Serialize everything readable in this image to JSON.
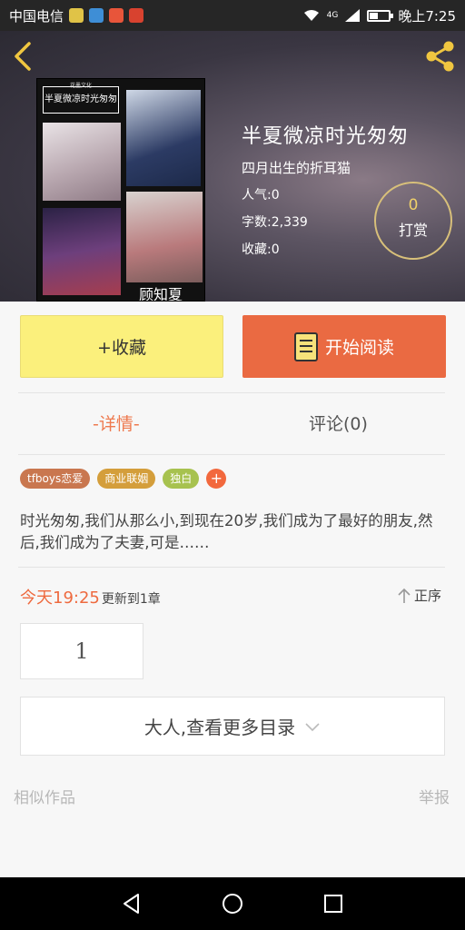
{
  "status_bar": {
    "carrier": "中国电信",
    "network": "4G",
    "time": "晚上7:25"
  },
  "hero": {
    "cover_title": "半夏微凉时光匆匆",
    "cover_subtitle": "花墨文化",
    "cover_author": "顾知夏",
    "title": "半夏微凉时光匆匆",
    "author": "四月出生的折耳猫",
    "popularity": "人气:0",
    "word_count": "字数:2,339",
    "favorites": "收藏:0",
    "reward_count": "0",
    "reward_label": "打赏"
  },
  "actions": {
    "collect_label": "+收藏",
    "read_label": "开始阅读"
  },
  "tabs": {
    "detail": "-详情-",
    "comments": "评论(0)"
  },
  "tags": [
    {
      "label": "tfboys恋爱",
      "color": "#c9774f"
    },
    {
      "label": "商业联姻",
      "color": "#d49e3b"
    },
    {
      "label": "独白",
      "color": "#a7c24f"
    }
  ],
  "intro": "时光匆匆,我们从那么小,到现在20岁,我们成为了最好的朋友,然后,我们成为了夫妻,可是……",
  "update": {
    "time": "今天19:25",
    "text": "更新到1章",
    "sort": "正序"
  },
  "chapter": "1",
  "more_catalog": "大人,查看更多目录",
  "footer": {
    "similar": "相似作品",
    "report": "举报"
  },
  "colors": {
    "accent": "#ea6a42",
    "collect_bg": "#fbf07c"
  }
}
